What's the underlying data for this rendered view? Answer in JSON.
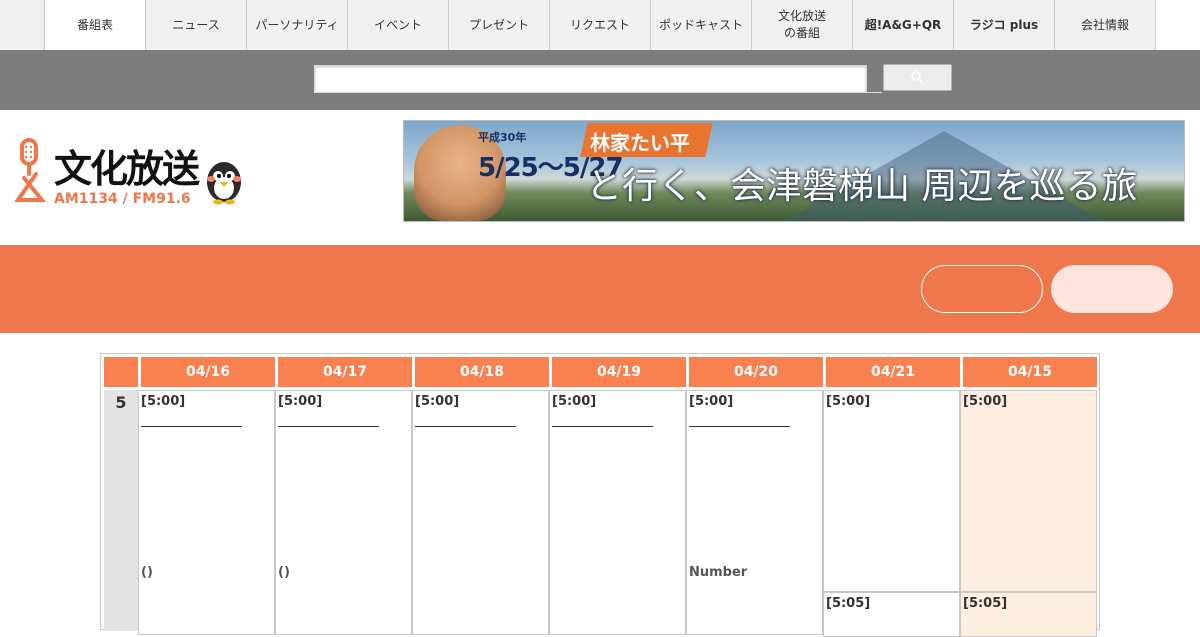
{
  "nav": {
    "items": [
      {
        "label": "番組表",
        "active": true
      },
      {
        "label": "ニュース",
        "active": false
      },
      {
        "label": "パーソナリティ",
        "active": false
      },
      {
        "label": "イベント",
        "active": false
      },
      {
        "label": "プレゼント",
        "active": false
      },
      {
        "label": "リクエスト",
        "active": false
      },
      {
        "label": "ポッドキャスト",
        "active": false
      },
      {
        "label": "文化放送\nの番組",
        "active": false
      },
      {
        "label": "超!A&G+QR",
        "active": false
      },
      {
        "label": "ラジコ plus",
        "active": false
      },
      {
        "label": "会社情報",
        "active": false
      }
    ]
  },
  "search": {
    "value": "",
    "placeholder": ""
  },
  "logo": {
    "name": "文化放送",
    "freq": "AM1134 / FM91.6"
  },
  "banner": {
    "year": "平成30年",
    "dates": "5/25〜5/27",
    "ribbon": "林家たい平",
    "headline": "と行く、会津磐梯山 周辺を巡る旅"
  },
  "band": {
    "pill1_label": "",
    "pill2_label": ""
  },
  "timetable": {
    "days": [
      "04/16",
      "04/17",
      "04/18",
      "04/19",
      "04/20",
      "04/21",
      "04/15"
    ],
    "hour": "5",
    "slots_500": [
      {
        "time": "[5:00]",
        "line": true,
        "note": "()"
      },
      {
        "time": "[5:00]",
        "line": true,
        "note": "()"
      },
      {
        "time": "[5:00]",
        "line": true,
        "note": ""
      },
      {
        "time": "[5:00]",
        "line": true,
        "note": ""
      },
      {
        "time": "[5:00]",
        "line": true,
        "note": "Number"
      },
      {
        "time": "[5:00]",
        "line": false,
        "note": ""
      },
      {
        "time": "[5:00]",
        "line": false,
        "note": ""
      }
    ],
    "slots_505": [
      "[5:05]",
      "[5:05]"
    ]
  },
  "colors": {
    "accent": "#ef774c",
    "header_cell": "#f9814f",
    "today_bg": "#fdeee0"
  }
}
